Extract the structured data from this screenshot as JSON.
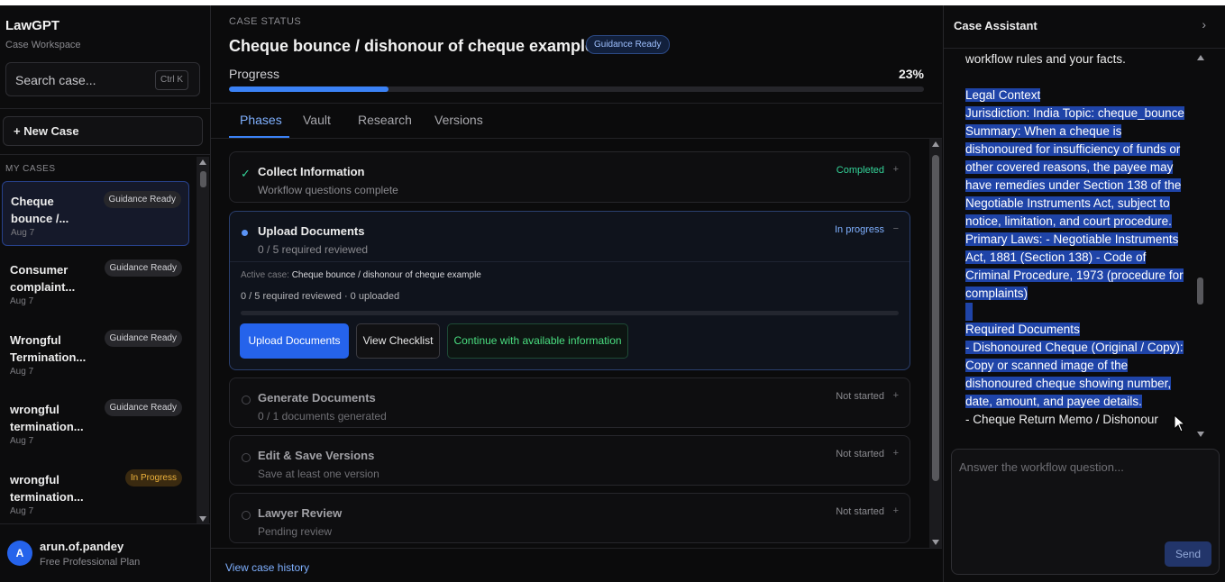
{
  "sidebar": {
    "brand": "LawGPT",
    "brand_sub": "Case Workspace",
    "search_placeholder": "Search case...",
    "search_shortcut": "Ctrl K",
    "new_case": "+ New Case",
    "section_label": "MY CASES",
    "cases": [
      {
        "title": "Cheque bounce /...",
        "badge": "Guidance Ready",
        "date": "Aug 7",
        "active": true
      },
      {
        "title": "Consumer complaint...",
        "badge": "Guidance Ready",
        "date": "Aug 7"
      },
      {
        "title": "Wrongful Termination...",
        "badge": "Guidance Ready",
        "date": "Aug 7"
      },
      {
        "title": "wrongful termination...",
        "badge": "Guidance Ready",
        "date": "Aug 7"
      },
      {
        "title": "wrongful termination...",
        "badge": "In Progress",
        "date": "Aug 7"
      }
    ],
    "user": {
      "initial": "A",
      "name": "arun.of.pandey",
      "plan": "Free Professional Plan"
    }
  },
  "main": {
    "status_label": "CASE STATUS",
    "title": "Cheque bounce / dishonour of cheque example",
    "badge": "Guidance Ready",
    "progress_label": "Progress",
    "progress_text": "23%",
    "progress_value": 0.23,
    "tabs": [
      "Phases",
      "Vault",
      "Research",
      "Versions"
    ],
    "active_tab": "Phases",
    "phases": [
      {
        "title": "Collect Information",
        "sub": "Workflow questions complete",
        "status": "Completed",
        "toggle": "+"
      },
      {
        "title": "Upload Documents",
        "sub": "0 / 5 required reviewed",
        "status": "In progress",
        "toggle": "−",
        "active_case_label": "Active case:",
        "active_case": "Cheque bounce / dishonour of cheque example",
        "stats": "0 / 5 required reviewed · 0 uploaded",
        "upload_button": "Upload Documents",
        "checklist_button": "View Checklist",
        "continue_button": "Continue with available information"
      },
      {
        "title": "Generate Documents",
        "sub": "0 / 1 documents generated",
        "status": "Not started",
        "toggle": "+"
      },
      {
        "title": "Edit & Save Versions",
        "sub": "Save at least one version",
        "status": "Not started",
        "toggle": "+"
      },
      {
        "title": "Lawyer Review",
        "sub": "Pending review",
        "status": "Not started",
        "toggle": "+"
      }
    ],
    "history_link": "View case history"
  },
  "assistant": {
    "title": "Case Assistant",
    "intro_tail": "workflow rules and your facts.",
    "legal_heading": "Legal Context",
    "legal_text": "Jurisdiction: India Topic: cheque_bounce Summary: When a cheque is dishonoured for insufficiency of funds or other covered reasons, the payee may have remedies under Section 138 of the Negotiable Instruments Act, subject to notice, limitation, and court procedure.",
    "primary_laws": "Primary Laws: - Negotiable Instruments Act, 1881 (Section 138) - Code of Criminal Procedure, 1973 (procedure for complaints)",
    "required_heading": "Required Documents",
    "doc1": "- Dishonoured Cheque (Original / Copy): Copy or scanned image of the dishonoured cheque showing number, date, amount, and payee details.",
    "doc2": "- Cheque Return Memo / Dishonour",
    "answer_placeholder": "Answer the workflow question...",
    "send": "Send"
  },
  "colors": {
    "accent": "#3b82f6",
    "completed": "#34d399",
    "in_progress_badge": "#f0b43c",
    "selection": "#1f44a8"
  }
}
